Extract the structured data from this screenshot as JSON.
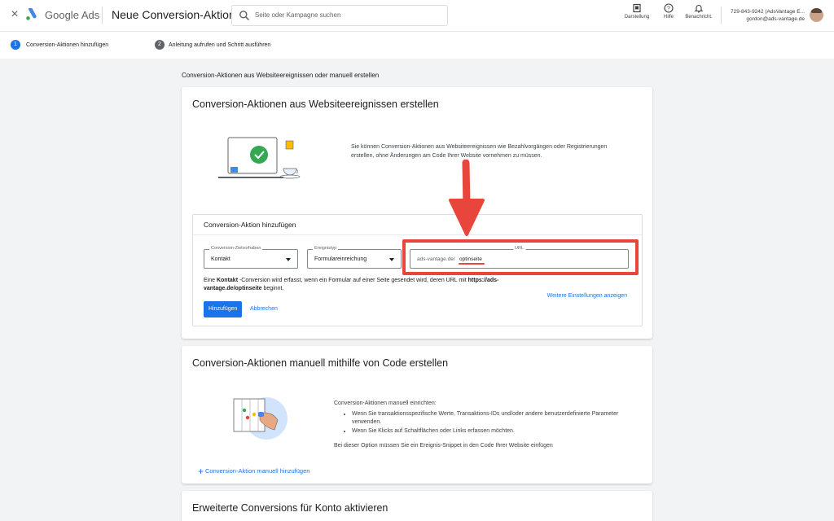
{
  "header": {
    "close_label": "×",
    "brand": "Google Ads",
    "page_title": "Neue Conversion-Aktion",
    "search_placeholder": "Seite oder Kampagne suchen",
    "actions": [
      {
        "label": "Darstellung",
        "icon": "appearance-icon"
      },
      {
        "label": "Hilfe",
        "icon": "help-icon"
      },
      {
        "label": "Benachricht.",
        "icon": "bell-icon"
      }
    ],
    "account_line1": "729-843-9242 (AdsVantage E...",
    "account_line2": "gordon@ads-vantage.de"
  },
  "steps": [
    {
      "number": "1",
      "label": "Conversion-Aktionen hinzufügen",
      "active": true
    },
    {
      "number": "2",
      "label": "Anleitung aufrufen und Schritt ausführen",
      "active": false
    }
  ],
  "section_heading": "Conversion-Aktionen aus Websiteereignissen oder manuell erstellen",
  "card_website": {
    "title": "Conversion-Aktionen aus Websiteereignissen erstellen",
    "description": "Sie können Conversion-Aktionen aus Websiteereignissen wie Bezahlvorgängen oder Registrierungen erstellen, ohne Änderungen am Code Ihrer Website vornehmen zu müssen.",
    "form": {
      "title": "Conversion-Aktion hinzufügen",
      "goal_label": "Conversion-Zielvorhaben",
      "goal_value": "Kontakt",
      "event_label": "Ereignistyp",
      "event_value": "Formulareinreichung",
      "url_label": "URL",
      "url_prefix": "ads-vantage.de/",
      "url_path": "optinseite",
      "hint_part1": "Eine ",
      "hint_bold1": "Kontakt",
      "hint_part2": " -Conversion wird erfasst, wenn ein Formular auf einer Seite gesendet wird, deren URL mit ",
      "hint_bold2": "https://ads-vantage.de/optinseite",
      "hint_part3": " beginnt.",
      "more_settings": "Weitere Einstellungen anzeigen",
      "add_button": "Hinzufügen",
      "cancel_button": "Abbrechen"
    }
  },
  "card_manual": {
    "title": "Conversion-Aktionen manuell mithilfe von Code erstellen",
    "intro": "Conversion-Aktionen manuell einrichten:",
    "bullets": [
      "Wenn Sie transaktionsspezifische Werte, Transaktions-IDs und/oder andere benutzerdefinierte Parameter verwenden.",
      "Wenn Sie Klicks auf Schaltflächen oder Links erfassen möchten."
    ],
    "snippet_note": "Bei dieser Option müssen Sie ein Ereignis-Snippet in den Code Ihrer Website einfügen",
    "add_link": "Conversion-Aktion manuell hinzufügen"
  },
  "card_enhanced": {
    "title": "Erweiterte Conversions für Konto aktivieren"
  },
  "colors": {
    "accent": "#1a73e8",
    "highlight": "#e8463d",
    "success": "#34a853"
  }
}
